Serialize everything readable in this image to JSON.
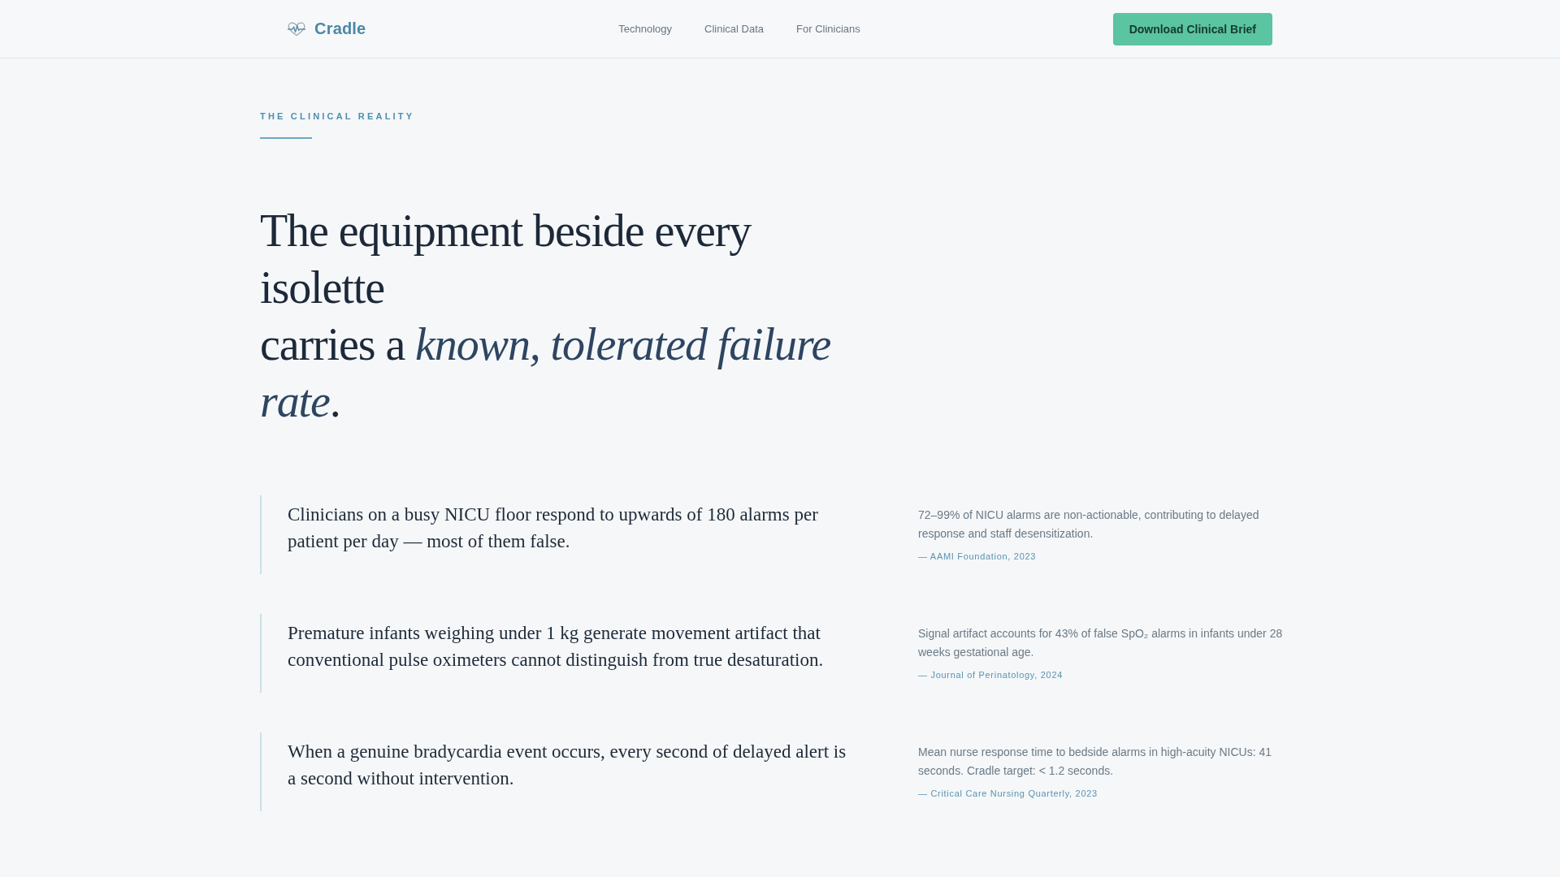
{
  "header": {
    "brand": "Cradle",
    "nav": [
      {
        "label": "Technology"
      },
      {
        "label": "Clinical Data"
      },
      {
        "label": "For Clinicians"
      }
    ],
    "cta": "Download Clinical Brief"
  },
  "section": {
    "eyebrow": "THE CLINICAL REALITY",
    "headline": [
      "The equipment beside every isolette",
      "carries a *known, tolerated failure rate*."
    ]
  },
  "facts": [
    {
      "statement": "Clinicians on a busy NICU floor respond to upwards of 180 alarms per patient per day — most of them false.",
      "note": "72–99% of NICU alarms are non-actionable, contributing to delayed response and staff desensitization.",
      "source": "— AAMI Foundation, 2023"
    },
    {
      "statement": "Premature infants weighing under 1 kg generate movement artifact that conventional pulse oximeters cannot distinguish from true desaturation.",
      "note": "Signal artifact accounts for 43% of false SpO₂ alarms in infants under 28 weeks gestational age.",
      "source": "— Journal of Perinatology, 2024"
    },
    {
      "statement": "When a genuine bradycardia event occurs, every second of delayed alert is a second without intervention.",
      "note": "Mean nurse response time to bedside alarms in high-acuity NICUs: 41 seconds. Cradle target: < 1.2 seconds.",
      "source": "— Critical Care Nursing Quarterly, 2023"
    }
  ]
}
